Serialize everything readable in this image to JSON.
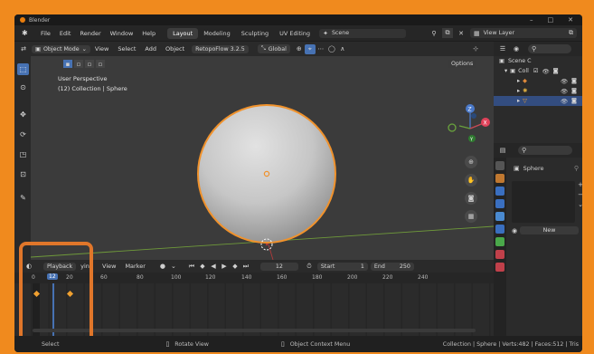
{
  "window": {
    "title": "Blender",
    "controls": [
      "–",
      "□",
      "✕"
    ]
  },
  "menubar": {
    "items": [
      "File",
      "Edit",
      "Render",
      "Window",
      "Help"
    ],
    "workspaces": [
      "Layout",
      "Modeling",
      "Sculpting",
      "UV Editing"
    ],
    "active_workspace": "Layout",
    "scene": "Scene",
    "view_layer": "View Layer"
  },
  "viewport_header": {
    "mode": "Object Mode",
    "menus": [
      "View",
      "Select",
      "Add",
      "Object"
    ],
    "addon": "RetopoFlow 3.2.5",
    "orientation": "Global",
    "options": "Options"
  },
  "viewport": {
    "info_line1": "User Perspective",
    "info_line2": "(12) Collection | Sphere",
    "gizmo_x": "X",
    "gizmo_y": "Y",
    "gizmo_z": "Z"
  },
  "timeline": {
    "playback": "Playback",
    "keying": "ying",
    "menus": [
      "View",
      "Marker"
    ],
    "current_frame": "12",
    "start_label": "Start",
    "start": "1",
    "end_label": "End",
    "end": "250",
    "ruler_left": [
      "0",
      "12",
      "20"
    ],
    "ruler_ticks": [
      "60",
      "80",
      "100",
      "120",
      "140",
      "160",
      "180",
      "200",
      "220",
      "240"
    ]
  },
  "outliner": {
    "scene_collection": "Scene C",
    "collection": "Coll",
    "search_placeholder": ""
  },
  "properties": {
    "object_name": "Sphere",
    "new_button": "New"
  },
  "statusbar": {
    "select": "Select",
    "rotate": "Rotate View",
    "context": "Object Context Menu",
    "stats": "Collection | Sphere | Verts:482 | Faces:512 | Tris"
  },
  "colors": {
    "accent": "#f08a1e",
    "highlight_box": "#e0762a",
    "selection_outline": "#f0922c",
    "active_blue": "#4772b3"
  }
}
